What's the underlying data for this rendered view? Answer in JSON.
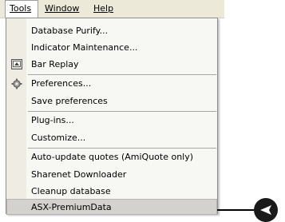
{
  "menubar": {
    "items": [
      {
        "label": "Tools",
        "mnemonic_index": 0
      },
      {
        "label": "Window",
        "mnemonic_index": 0
      },
      {
        "label": "Help",
        "mnemonic_index": 0
      }
    ]
  },
  "menu": {
    "items": [
      {
        "label": "Database Purify..."
      },
      {
        "label": "Indicator Maintenance..."
      },
      {
        "label": "Bar Replay",
        "icon": "bar-replay-icon"
      },
      {
        "label": "Preferences...",
        "icon": "gear-icon"
      },
      {
        "label": "Save preferences"
      },
      {
        "label": "Plug-ins..."
      },
      {
        "label": "Customize..."
      },
      {
        "label": "Auto-update quotes (AmiQuote only)"
      },
      {
        "label": "Sharenet Downloader"
      },
      {
        "label": "Cleanup database"
      },
      {
        "label": "ASX-PremiumData",
        "highlighted": true
      }
    ]
  },
  "colors": {
    "menubar_bg": "#ece9d8",
    "menu_bg": "#f7f7f4",
    "highlight_bg": "#d3d2cf",
    "callout": "#1a1a1a"
  }
}
